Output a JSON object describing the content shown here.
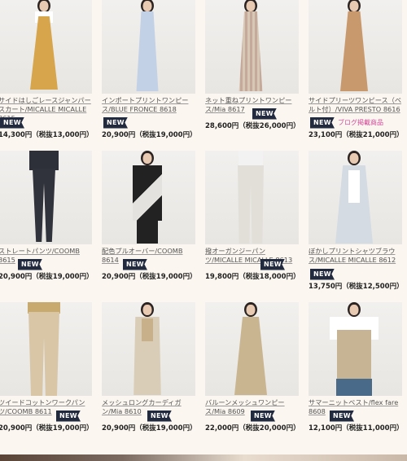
{
  "products": [
    {
      "title": "サイドはしごレースジャンパースカート/MICALLE MICALLE 8615",
      "badge": "NEW",
      "blog": "",
      "price": "14,300円（税抜13,000円）",
      "colors": {
        "top": "#ffffff",
        "main": "#d6a54c",
        "legs": "#e6c8a8"
      }
    },
    {
      "title": "インポートプリントワンピース/BLUE FRONCE 8618",
      "badge": "NEW",
      "blog": "",
      "price": "20,900円（税抜19,000円）",
      "colors": {
        "top": "#c7d3e6",
        "main": "#b8c8e0",
        "legs": "#e6c8a8"
      }
    },
    {
      "title": "ネット重ねプリントワンピース/Mia 8617",
      "badge": "NEW",
      "blog": "",
      "price": "28,600円（税抜26,000円）",
      "colors": {
        "top": "#d6c7b6",
        "main": "#c9b3a8",
        "legs": "#e6c8a8"
      }
    },
    {
      "title": "サイドプリーツワンピース（ベルト付）/VIVA PRESTO 8616",
      "badge": "NEW",
      "blog": "ブログ掲載商品",
      "price": "23,100円（税抜21,000円）",
      "colors": {
        "top": "#c79a6e",
        "main": "#c79a6e",
        "legs": "#e6c8a8"
      }
    },
    {
      "title": "ストレートパンツ/COOMB 8615",
      "badge": "NEW",
      "blog": "",
      "price": "20,900円（税抜19,000円）",
      "colors": {
        "top": "#2d3038",
        "main": "#2d3038",
        "legs": "#2d3038"
      }
    },
    {
      "title": "配色プルオーバー/COOMB 8614",
      "badge": "NEW",
      "blog": "",
      "price": "20,900円（税抜19,000円）",
      "colors": {
        "top": "#222222",
        "main": "#dedcd8",
        "legs": "#222222"
      }
    },
    {
      "title": "撥オーガンジーパンツ/MICALLE MICALLE 8613",
      "badge": "NEW",
      "blog": "",
      "price": "19,800円（税抜18,000円）",
      "colors": {
        "top": "#efefef",
        "main": "#e4e1dc",
        "legs": "#e4e1dc"
      }
    },
    {
      "title": "ぼかしプリントシャツブラウス/MICALLE MICALLE 8612",
      "badge": "NEW",
      "blog": "",
      "price": "13,750円（税抜12,500円）",
      "colors": {
        "top": "#dfe3e8",
        "main": "#d4dbe3",
        "legs": "#cfd3da"
      }
    },
    {
      "title": "ツイードコットンワークパンツ/COOMB 8611",
      "badge": "NEW",
      "blog": "",
      "price": "20,900円（税抜19,000円）",
      "colors": {
        "top": "#c8a96e",
        "main": "#d8c6a7",
        "legs": "#d8c6a7"
      }
    },
    {
      "title": "メッシュロングカーディガン/Mia 8610",
      "badge": "NEW",
      "blog": "",
      "price": "20,900円（税抜19,000円）",
      "colors": {
        "top": "#d9cdb7",
        "main": "#d9cdb7",
        "legs": "#d9cdb7"
      }
    },
    {
      "title": "バルーンメッシュワンピース/Mia 8609",
      "badge": "NEW",
      "blog": "",
      "price": "22,000円（税抜20,000円）",
      "colors": {
        "top": "#c9b590",
        "main": "#c9b590",
        "legs": "#c9b590"
      }
    },
    {
      "title": "サマーニットベスト/flex fare 8608",
      "badge": "NEW",
      "blog": "",
      "price": "12,100円（税抜11,000円）",
      "colors": {
        "top": "#ffffff",
        "main": "#c7b494",
        "legs": "#4a6a8a"
      }
    }
  ]
}
